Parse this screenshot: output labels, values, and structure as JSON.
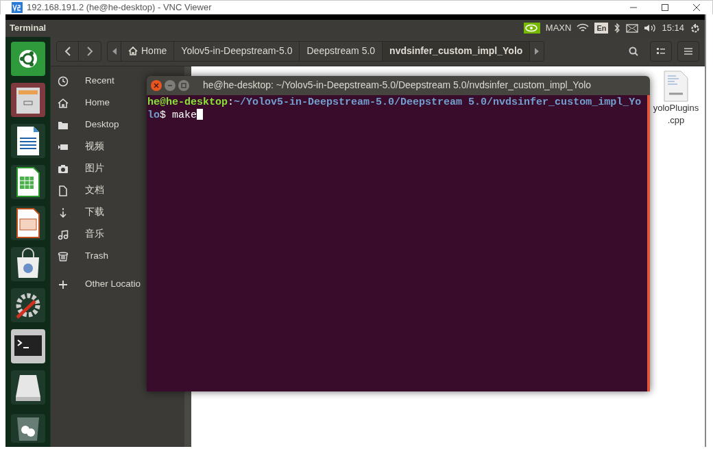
{
  "window": {
    "title": "192.168.191.2 (he@he-desktop) - VNC Viewer"
  },
  "top_panel": {
    "app_title": "Terminal",
    "power_mode": "MAXN",
    "keyboard_layout": "En",
    "clock": "15:14"
  },
  "files": {
    "breadcrumbs": [
      {
        "label": "Home",
        "selected": false
      },
      {
        "label": "Yolov5-in-Deepstream-5.0",
        "selected": false
      },
      {
        "label": "Deepstream 5.0",
        "selected": false
      },
      {
        "label": "nvdsinfer_custom_impl_Yolo",
        "selected": true
      }
    ],
    "sidebar": [
      {
        "label": "Recent"
      },
      {
        "label": "Home"
      },
      {
        "label": "Desktop"
      },
      {
        "label": "视频"
      },
      {
        "label": "图片"
      },
      {
        "label": "文档"
      },
      {
        "label": "下载"
      },
      {
        "label": "音乐"
      },
      {
        "label": "Trash"
      },
      {
        "label": "Other Locatio"
      }
    ],
    "items": [
      {
        "name_lines": [
          "yoloPlugins",
          ".cpp"
        ]
      }
    ]
  },
  "terminal": {
    "title": "he@he-desktop: ~/Yolov5-in-Deepstream-5.0/Deepstream 5.0/nvdsinfer_custom_impl_Yolo",
    "user_host": "he@he-desktop",
    "separator": ":",
    "prompt_symbol": "$",
    "path": "~/Yolov5-in-Deepstream-5.0/Deepstream 5.0/nvdsinfer_custom_impl_Yolo",
    "command": "make"
  }
}
